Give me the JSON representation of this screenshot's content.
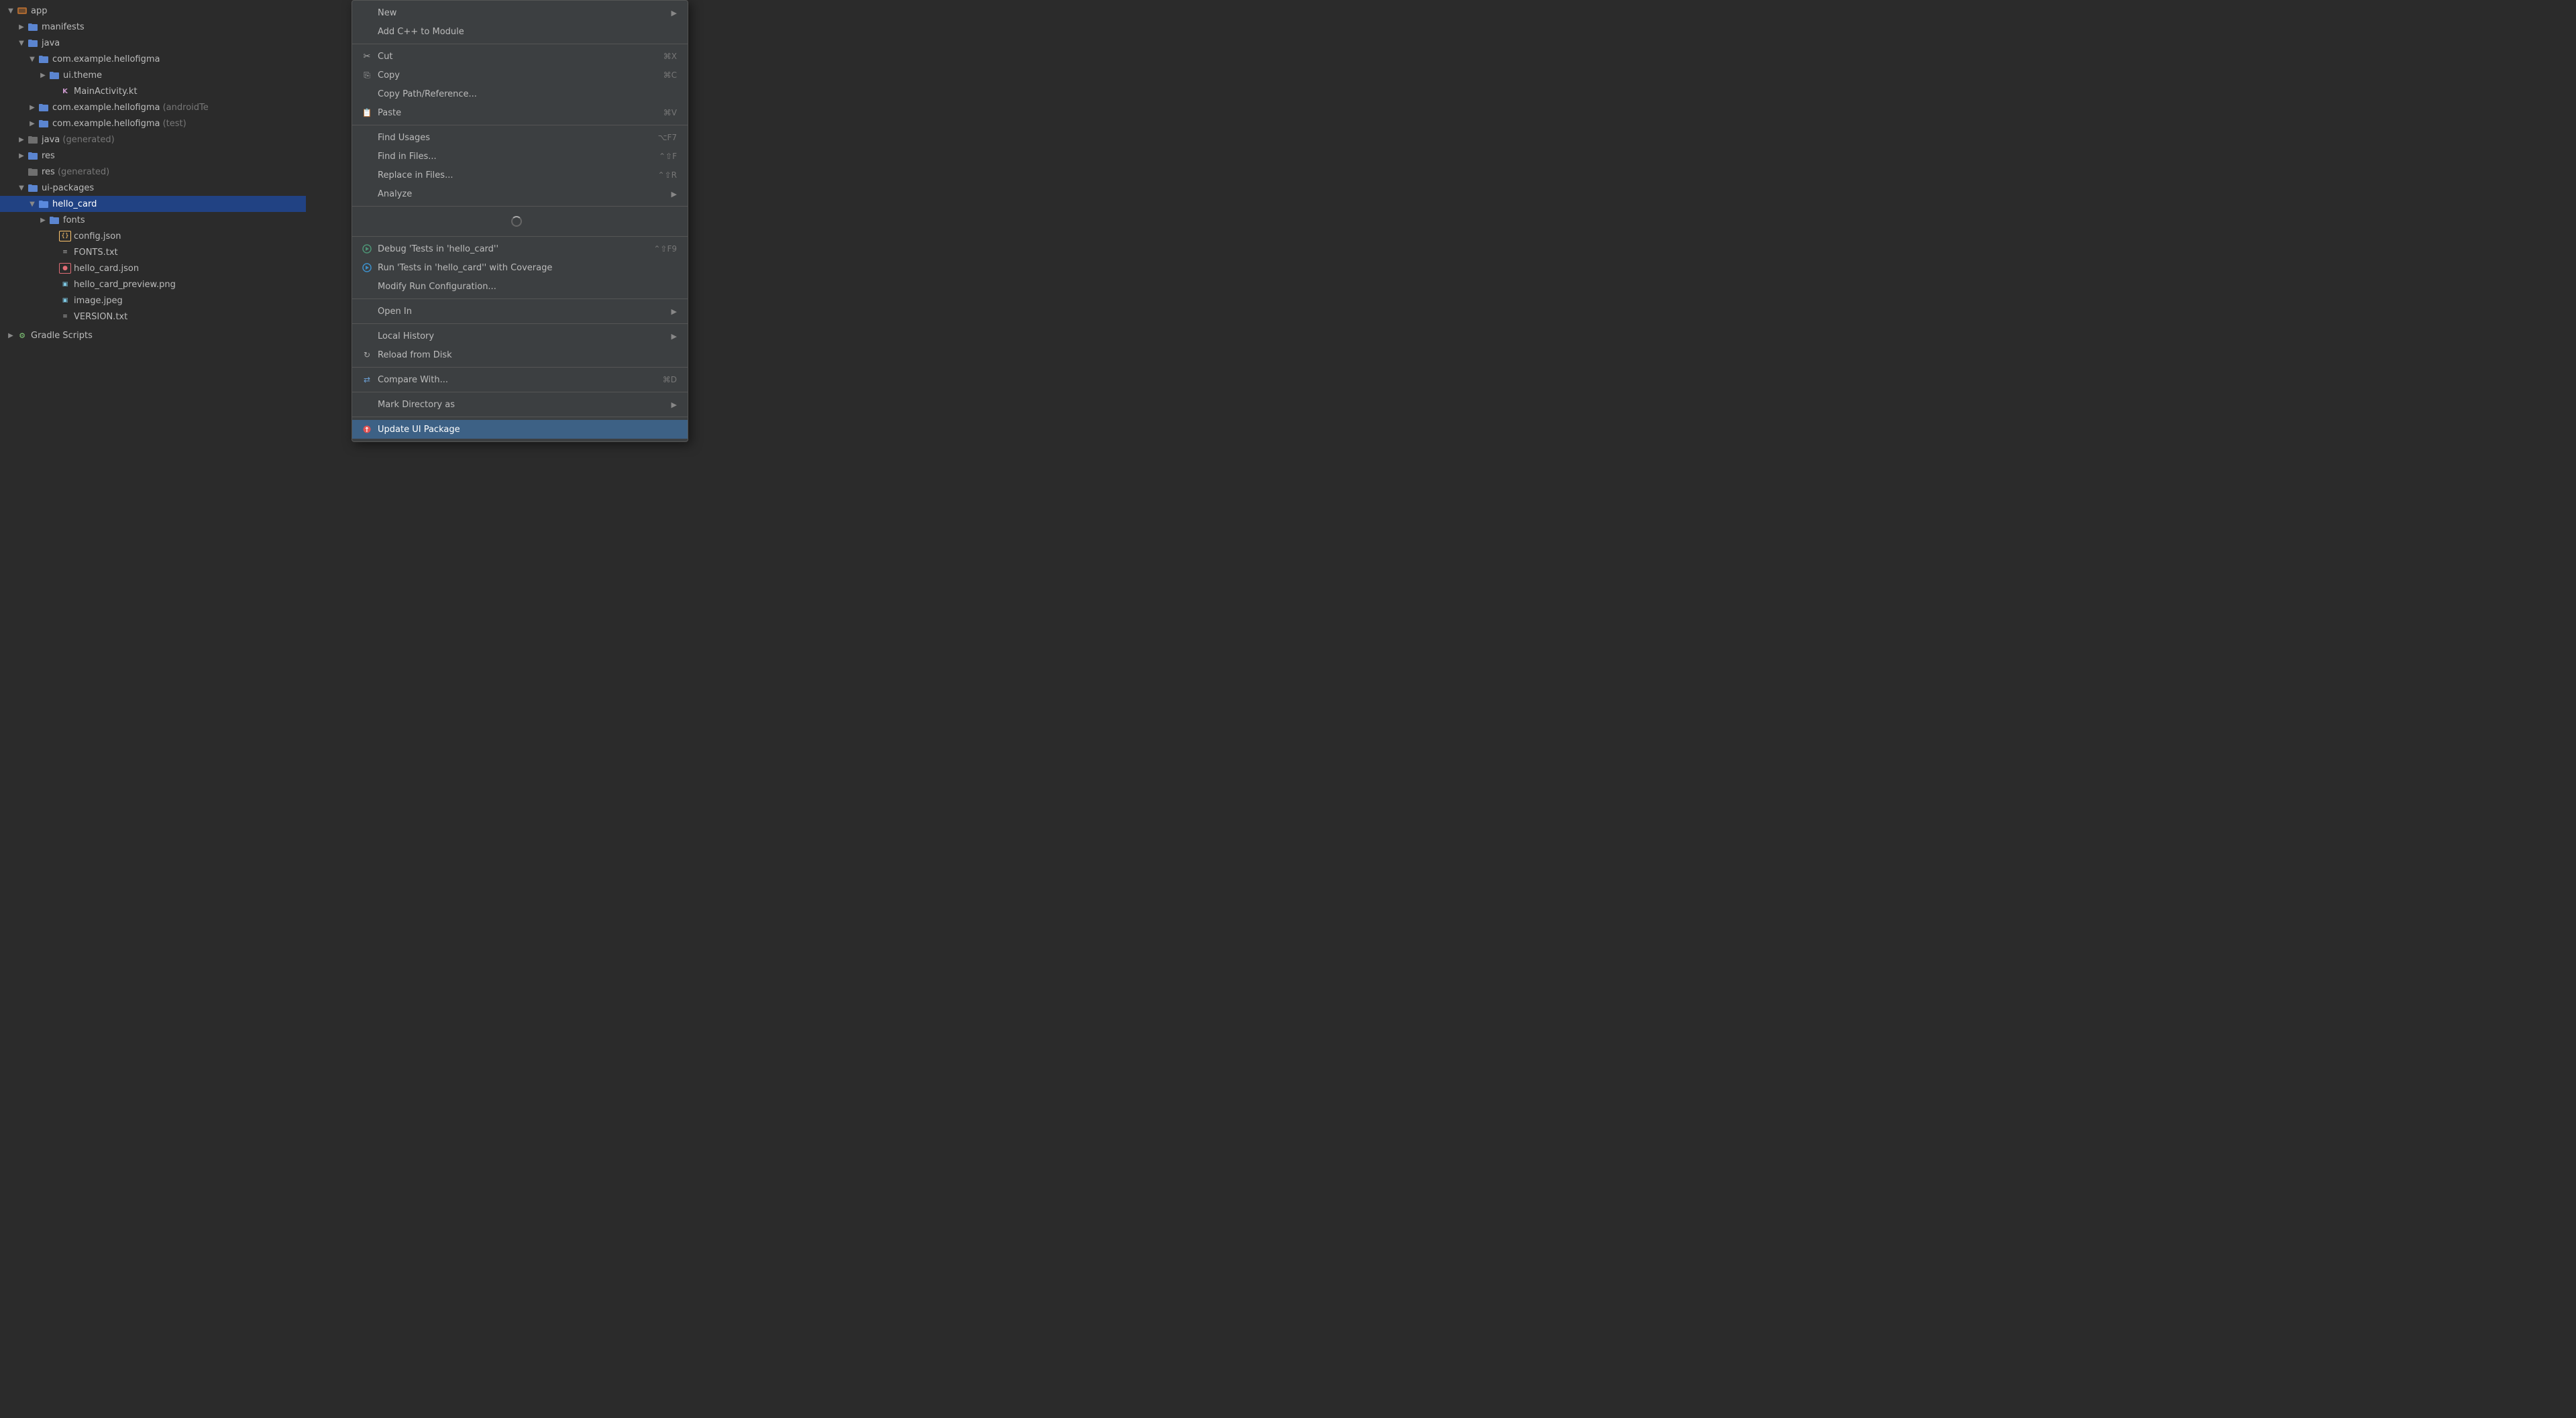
{
  "fileTree": {
    "items": [
      {
        "id": "app",
        "level": 0,
        "type": "module",
        "arrow": "▼",
        "label": "app",
        "icon": "module",
        "selected": false
      },
      {
        "id": "manifests",
        "level": 1,
        "type": "folder",
        "arrow": "▶",
        "label": "manifests",
        "icon": "folder",
        "selected": false
      },
      {
        "id": "java",
        "level": 1,
        "type": "folder",
        "arrow": "▼",
        "label": "java",
        "icon": "folder",
        "selected": false
      },
      {
        "id": "com.example.hellofigma",
        "level": 2,
        "type": "folder",
        "arrow": "▼",
        "label": "com.example.hellofigma",
        "icon": "folder",
        "selected": false
      },
      {
        "id": "ui.theme",
        "level": 3,
        "type": "folder",
        "arrow": "▶",
        "label": "ui.theme",
        "icon": "folder",
        "selected": false
      },
      {
        "id": "MainActivity.kt",
        "level": 3,
        "type": "file-kt",
        "arrow": "",
        "label": "MainActivity.kt",
        "icon": "kt",
        "selected": false
      },
      {
        "id": "com.example.hellofigma.test",
        "level": 2,
        "type": "folder",
        "arrow": "▶",
        "label": "com.example.hellofigma",
        "icon": "folder",
        "suffix": " (androidTe",
        "muted": true,
        "selected": false
      },
      {
        "id": "com.example.hellofigma.test2",
        "level": 2,
        "type": "folder",
        "arrow": "▶",
        "label": "com.example.hellofigma",
        "icon": "folder",
        "suffix": " (test)",
        "muted": true,
        "selected": false
      },
      {
        "id": "java-generated",
        "level": 1,
        "type": "folder",
        "arrow": "▶",
        "label": "java",
        "icon": "folder-gen",
        "suffix": " (generated)",
        "muted": true,
        "selected": false
      },
      {
        "id": "res",
        "level": 1,
        "type": "folder",
        "arrow": "▶",
        "label": "res",
        "icon": "folder",
        "selected": false
      },
      {
        "id": "res-generated",
        "level": 1,
        "type": "folder",
        "arrow": "",
        "label": "res",
        "icon": "folder",
        "suffix": " (generated)",
        "muted": true,
        "selected": false
      },
      {
        "id": "ui-packages",
        "level": 1,
        "type": "folder",
        "arrow": "▼",
        "label": "ui-packages",
        "icon": "folder",
        "selected": false
      },
      {
        "id": "hello_card",
        "level": 2,
        "type": "folder",
        "arrow": "▼",
        "label": "hello_card",
        "icon": "folder",
        "selected": true
      },
      {
        "id": "fonts",
        "level": 3,
        "type": "folder",
        "arrow": "▶",
        "label": "fonts",
        "icon": "folder",
        "selected": false
      },
      {
        "id": "config.json",
        "level": 3,
        "type": "file-json",
        "arrow": "",
        "label": "config.json",
        "icon": "json",
        "selected": false
      },
      {
        "id": "FONTS.txt",
        "level": 3,
        "type": "file-txt",
        "arrow": "",
        "label": "FONTS.txt",
        "icon": "txt",
        "selected": false
      },
      {
        "id": "hello_card.json",
        "level": 3,
        "type": "file-json-red",
        "arrow": "",
        "label": "hello_card.json",
        "icon": "json-red",
        "selected": false
      },
      {
        "id": "hello_card_preview.png",
        "level": 3,
        "type": "file-png",
        "arrow": "",
        "label": "hello_card_preview.png",
        "icon": "png",
        "selected": false
      },
      {
        "id": "image.jpeg",
        "level": 3,
        "type": "file-jpeg",
        "arrow": "",
        "label": "image.jpeg",
        "icon": "jpeg",
        "selected": false
      },
      {
        "id": "VERSION.txt",
        "level": 3,
        "type": "file-txt",
        "arrow": "",
        "label": "VERSION.txt",
        "icon": "txt",
        "selected": false
      },
      {
        "id": "gradle-scripts",
        "level": 0,
        "type": "folder",
        "arrow": "▶",
        "label": "Gradle Scripts",
        "icon": "gradle",
        "selected": false
      }
    ]
  },
  "contextMenu": {
    "items": [
      {
        "id": "new",
        "type": "item",
        "icon": "",
        "label": "New",
        "shortcut": "",
        "hasArrow": true
      },
      {
        "id": "add-cpp",
        "type": "item",
        "icon": "",
        "label": "Add C++ to Module",
        "shortcut": "",
        "hasArrow": false
      },
      {
        "id": "sep1",
        "type": "separator"
      },
      {
        "id": "cut",
        "type": "item",
        "icon": "cut",
        "label": "Cut",
        "shortcut": "⌘X",
        "hasArrow": false
      },
      {
        "id": "copy",
        "type": "item",
        "icon": "copy",
        "label": "Copy",
        "shortcut": "⌘C",
        "hasArrow": false
      },
      {
        "id": "copy-path",
        "type": "item",
        "icon": "",
        "label": "Copy Path/Reference...",
        "shortcut": "",
        "hasArrow": false
      },
      {
        "id": "paste",
        "type": "item",
        "icon": "paste",
        "label": "Paste",
        "shortcut": "⌘V",
        "hasArrow": false
      },
      {
        "id": "sep2",
        "type": "separator"
      },
      {
        "id": "find-usages",
        "type": "item",
        "icon": "",
        "label": "Find Usages",
        "shortcut": "⌥F7",
        "hasArrow": false
      },
      {
        "id": "find-in-files",
        "type": "item",
        "icon": "",
        "label": "Find in Files...",
        "shortcut": "⌃⇧F",
        "hasArrow": false
      },
      {
        "id": "replace-in-files",
        "type": "item",
        "icon": "",
        "label": "Replace in Files...",
        "shortcut": "⌃⇧R",
        "hasArrow": false
      },
      {
        "id": "analyze",
        "type": "item",
        "icon": "",
        "label": "Analyze",
        "shortcut": "",
        "hasArrow": true
      },
      {
        "id": "sep3",
        "type": "separator"
      },
      {
        "id": "spinner",
        "type": "spinner"
      },
      {
        "id": "sep4",
        "type": "separator"
      },
      {
        "id": "debug-tests",
        "type": "item",
        "icon": "debug",
        "label": "Debug 'Tests in 'hello_card''",
        "shortcut": "⌃⇧F9",
        "hasArrow": false
      },
      {
        "id": "run-coverage",
        "type": "item",
        "icon": "run-coverage",
        "label": "Run 'Tests in 'hello_card'' with Coverage",
        "shortcut": "",
        "hasArrow": false
      },
      {
        "id": "modify-run",
        "type": "item",
        "icon": "",
        "label": "Modify Run Configuration...",
        "shortcut": "",
        "hasArrow": false
      },
      {
        "id": "sep5",
        "type": "separator"
      },
      {
        "id": "open-in",
        "type": "item",
        "icon": "",
        "label": "Open In",
        "shortcut": "",
        "hasArrow": true
      },
      {
        "id": "sep6",
        "type": "separator"
      },
      {
        "id": "local-history",
        "type": "item",
        "icon": "",
        "label": "Local History",
        "shortcut": "",
        "hasArrow": true
      },
      {
        "id": "reload-from-disk",
        "type": "item",
        "icon": "reload",
        "label": "Reload from Disk",
        "shortcut": "",
        "hasArrow": false
      },
      {
        "id": "sep7",
        "type": "separator"
      },
      {
        "id": "compare-with",
        "type": "item",
        "icon": "compare",
        "label": "Compare With...",
        "shortcut": "⌘D",
        "hasArrow": false
      },
      {
        "id": "sep8",
        "type": "separator"
      },
      {
        "id": "mark-directory",
        "type": "item",
        "icon": "",
        "label": "Mark Directory as",
        "shortcut": "",
        "hasArrow": true
      },
      {
        "id": "sep9",
        "type": "separator"
      },
      {
        "id": "update-ui-package",
        "type": "item",
        "icon": "update",
        "label": "Update UI Package",
        "shortcut": "",
        "hasArrow": false,
        "highlighted": true
      }
    ]
  }
}
